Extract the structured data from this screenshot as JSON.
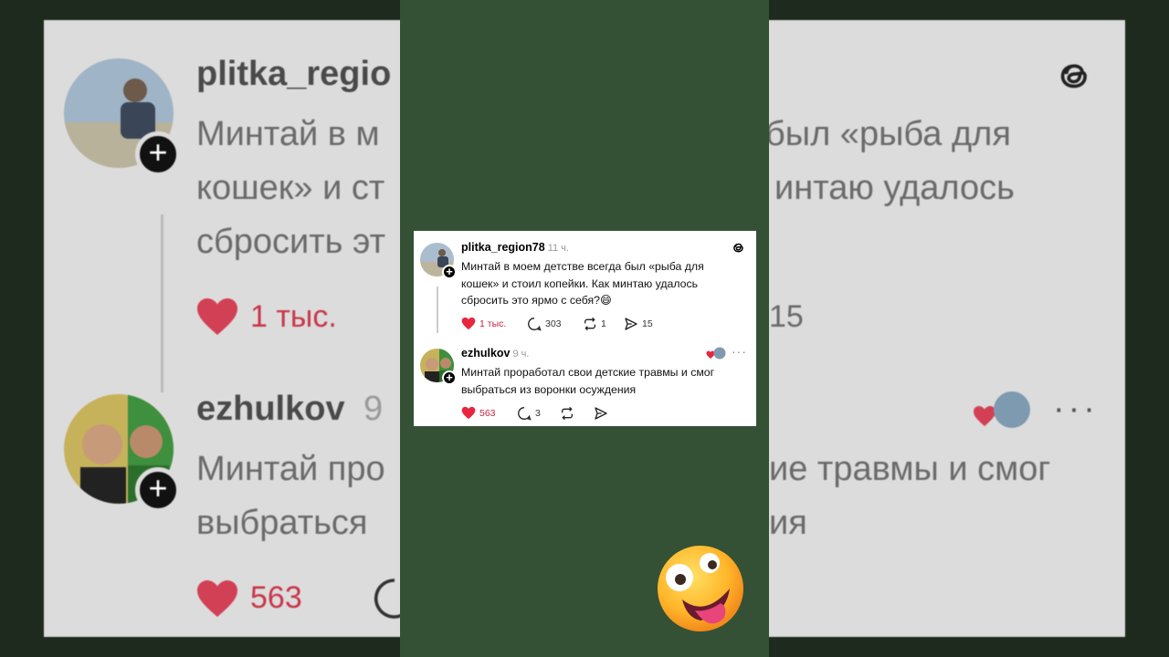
{
  "post": {
    "username": "plitka_region78",
    "time": "11 ч.",
    "text": "Минтай в моем детстве всегда был «рыба для кошек» и стоил копейки. Как минтаю удалось сбросить это ярмо с себя?😄",
    "likes": "1 тыс.",
    "comments": "303",
    "reposts": "1",
    "shares": "15",
    "brand_icon": "threads-icon"
  },
  "reply": {
    "username": "ezhulkov",
    "time": "9 ч.",
    "text": "Минтай проработал свои детские травмы и смог выбраться из воронки осуждения",
    "likes": "563",
    "comments": "3",
    "more": "···"
  },
  "background": {
    "post_user": "plitka_regio",
    "post_line1": "Минтай в м",
    "post_line1b": "был «рыба для",
    "post_line2": "кошек» и ст",
    "post_line2b": "интаю удалось",
    "post_line3": "сбросить эт",
    "post_likes": "1 тыс.",
    "post_shares": "15",
    "reply_user": "ezhulkov",
    "reply_time": "9",
    "reply_line1": "Минтай про",
    "reply_line1b": "ие травмы и смог",
    "reply_line2": "выбраться",
    "reply_line2b": "ия",
    "reply_likes": "563"
  },
  "colors": {
    "accent_red": "#e8263f",
    "center_green": "#355135",
    "card_bg": "#ffffff"
  }
}
